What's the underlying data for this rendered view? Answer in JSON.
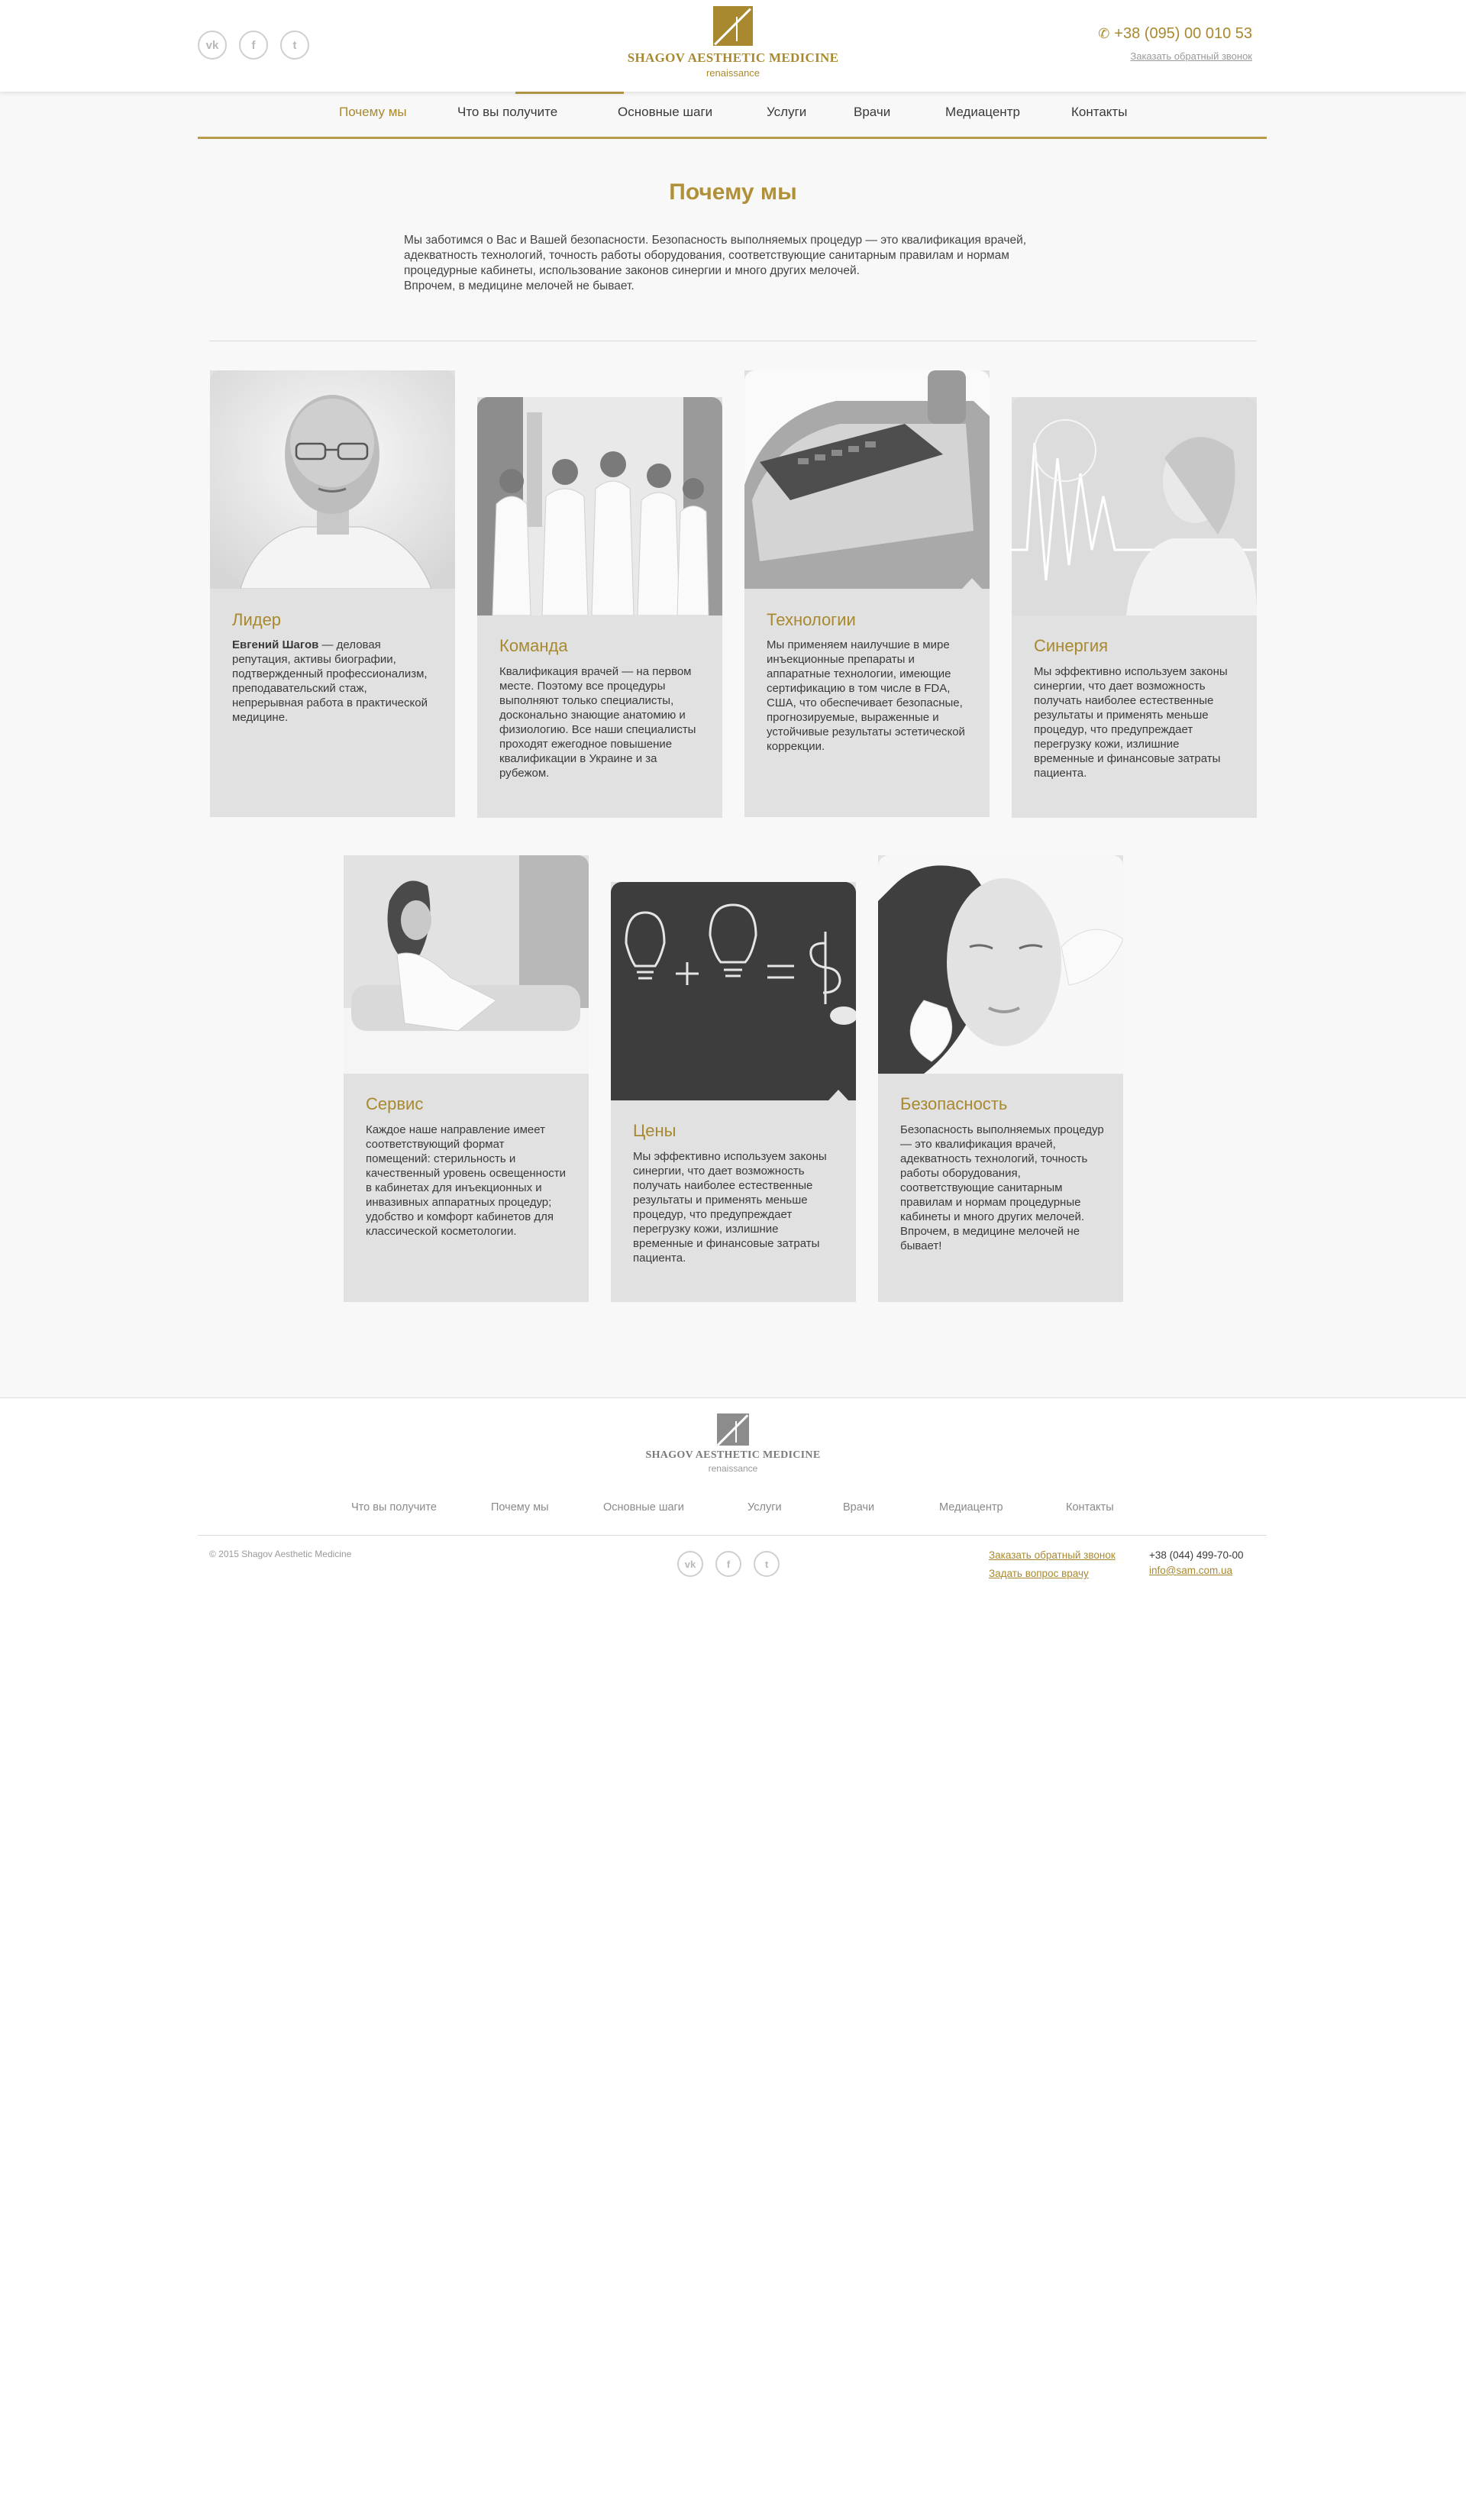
{
  "header": {
    "social": [
      "vk",
      "f",
      "t"
    ],
    "logo_title": "SHAGOV AESTHETIC MEDICINE",
    "logo_sub": "renaissance",
    "phone": "+38 (095) 00 010 53",
    "callback": "Заказать обратный звонок"
  },
  "nav": {
    "items": [
      "Почему мы",
      "Что вы получите",
      "Основные шаги",
      "Услуги",
      "Врачи",
      "Медиацентр",
      "Контакты"
    ],
    "active": "Почему мы"
  },
  "page": {
    "title": "Почему мы",
    "intro_1": "Мы заботимся о Вас и Вашей безопасности. Безопасность выполняемых процедур — это квалификация врачей, адекватность технологий, точность работы оборудования, соответствующие санитарным правилам и нормам процедурные кабинеты, использование законов синергии и много других мелочей.",
    "intro_2": "Впрочем, в медицине мелочей не бывает."
  },
  "cards": [
    {
      "title": "Лидер",
      "bold": "Евгений Шагов",
      "text": " — деловая репутация, активы биографии, подтвержденный профессионализм, преподавательский стаж, непрерывная работа в практической медицине."
    },
    {
      "title": "Команда",
      "text": "Квалификация врачей — на первом месте. Поэтому все процедуры выполняют только специалисты, досконально знающие анатомию и физиологию. Все наши специалисты проходят ежегодное повышение квалификации в Украине и за рубежом."
    },
    {
      "title": "Технологии",
      "text": "Мы применяем наилучшие в мире инъекционные препараты и аппаратные технологии, имеющие сертификацию в том числе в FDA, США, что обеспечивает безопасные, прогнозируемые, выраженные и устойчивые результаты эстетической коррекции."
    },
    {
      "title": "Синергия",
      "text": "Мы эффективно используем законы синергии, что дает возможность получать наиболее естественные результаты и применять меньше процедур, что предупреждает перегрузку кожи, излишние временные и финансовые затраты пациента."
    },
    {
      "title": "Сервис",
      "text": "Каждое наше направление имеет соответствующий формат помещений: стерильность и качественный уровень освещенности в кабинетах для инъекционных и инвазивных аппаратных процедур; удобство и комфорт кабинетов для классической косметологии."
    },
    {
      "title": "Цены",
      "text": "Мы эффективно используем законы синергии, что дает возможность получать наиболее естественные результаты и применять меньше процедур, что предупреждает перегрузку кожи, излишние временные и финансовые затраты пациента."
    },
    {
      "title": "Безопасность",
      "text": "Безопасность выполняемых процедур — это квалификация врачей, адекватность технологий, точность работы оборудования, соответствующие санитарным правилам и нормам процедурные кабинеты и много других мелочей. Впрочем, в медицине мелочей не бывает!"
    }
  ],
  "footer": {
    "logo_title": "SHAGOV AESTHETIC MEDICINE",
    "logo_sub": "renaissance",
    "nav": [
      "Что вы получите",
      "Почему мы",
      "Основные шаги",
      "Услуги",
      "Врачи",
      "Медиацентр",
      "Контакты"
    ],
    "copyright": "© 2015 Shagov Aesthetic Medicine",
    "callback": "Заказать обратный звонок",
    "ask": "Задать вопрос врачу",
    "phone": "+38 (044) 499-70-00",
    "email": "info@sam.com.ua"
  },
  "colors": {
    "gold": "#a8892f",
    "card_bg": "#e1e1e1",
    "page_bg": "#f8f8f8"
  },
  "icons": {
    "social": [
      "vk-icon",
      "facebook-icon",
      "twitter-icon"
    ],
    "phone": "phone-icon",
    "logo": "logo-mark-icon"
  }
}
